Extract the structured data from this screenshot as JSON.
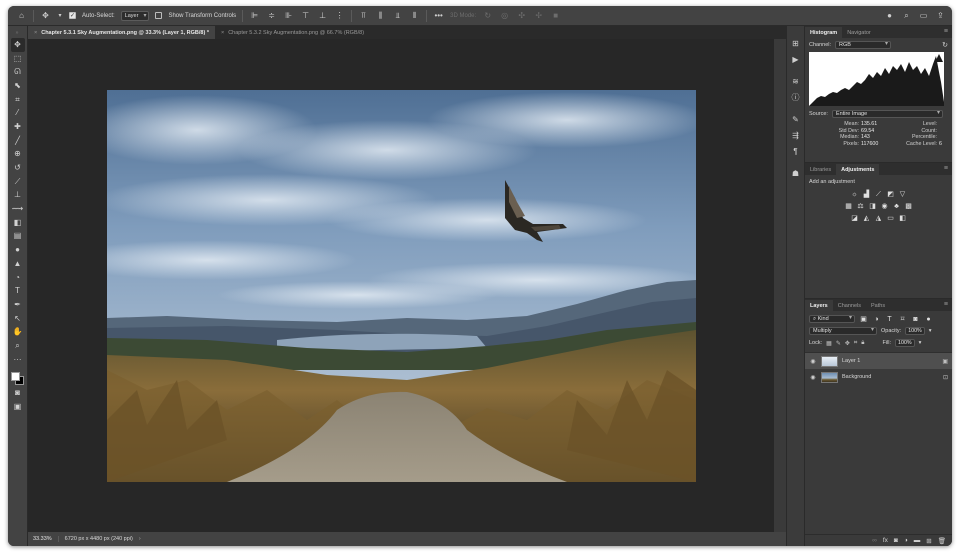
{
  "options_bar": {
    "auto_select_label": "Auto-Select:",
    "auto_select_value": "Layer",
    "transform_label": "Show Transform Controls",
    "mode_label": "3D Mode:"
  },
  "tabs": [
    {
      "label": "Chapter 5.3.1 Sky Augmentation.png @ 33.3% (Layer 1, RGB/8) *",
      "active": true
    },
    {
      "label": "Chapter 5.3.2 Sky Augmentation.png @ 66.7% (RGB/8)",
      "active": false
    }
  ],
  "status": {
    "zoom": "33.33%",
    "doc_size": "6720 px x 4480 px (240 ppi)"
  },
  "histogram": {
    "tabs": [
      "Histogram",
      "Navigator"
    ],
    "channel_label": "Channel:",
    "channel_value": "RGB",
    "source_label": "Source:",
    "source_value": "Entire Image",
    "stats": {
      "mean_label": "Mean:",
      "mean": "135.61",
      "std_label": "Std Dev:",
      "std": "69.54",
      "median_label": "Median:",
      "median": "143",
      "pixels_label": "Pixels:",
      "pixels": "117600",
      "level_label": "Level:",
      "level": "",
      "count_label": "Count:",
      "count": "",
      "percentile_label": "Percentile:",
      "percentile": "",
      "cache_label": "Cache Level:",
      "cache": "6"
    }
  },
  "adjustments": {
    "tabs": [
      "Libraries",
      "Adjustments"
    ],
    "hint": "Add an adjustment"
  },
  "layers": {
    "tabs": [
      "Layers",
      "Channels",
      "Paths"
    ],
    "filter_value": "Kind",
    "blend_mode": "Multiply",
    "opacity_label": "Opacity:",
    "opacity": "100%",
    "lock_label": "Lock:",
    "fill_label": "Fill:",
    "fill": "100%",
    "items": [
      {
        "name": "Layer 1",
        "selected": true
      },
      {
        "name": "Background",
        "selected": false
      }
    ]
  }
}
